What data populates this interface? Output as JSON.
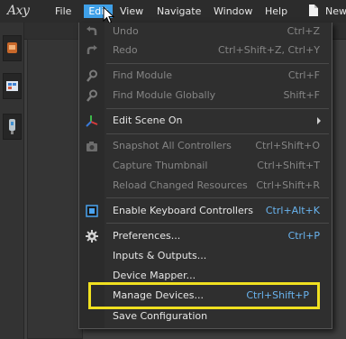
{
  "app": {
    "logo": "Axy"
  },
  "menubar": {
    "items": [
      {
        "label": "File"
      },
      {
        "label": "Edit"
      },
      {
        "label": "View"
      },
      {
        "label": "Navigate"
      },
      {
        "label": "Window"
      },
      {
        "label": "Help"
      },
      {
        "label": "New"
      }
    ],
    "active_color": "#3fa0e8"
  },
  "edit_menu": {
    "items": [
      {
        "label": "Undo",
        "shortcut": "Ctrl+Z",
        "enabled": false,
        "icon": "undo-icon"
      },
      {
        "label": "Redo",
        "shortcut": "Ctrl+Shift+Z, Ctrl+Y",
        "enabled": false,
        "icon": "redo-icon"
      },
      {
        "label": "Find Module",
        "shortcut": "Ctrl+F",
        "enabled": false,
        "icon": "magnifier-icon"
      },
      {
        "label": "Find Module Globally",
        "shortcut": "Shift+F",
        "enabled": false,
        "icon": "magnifier-icon"
      },
      {
        "label": "Edit Scene On",
        "shortcut": "",
        "enabled": true,
        "icon": "axes-icon",
        "submenu": true
      },
      {
        "label": "Snapshot All Controllers",
        "shortcut": "Ctrl+Shift+O",
        "enabled": false,
        "icon": "camera-icon"
      },
      {
        "label": "Capture Thumbnail",
        "shortcut": "Ctrl+Shift+T",
        "enabled": false
      },
      {
        "label": "Reload Changed Resources",
        "shortcut": "Ctrl+Shift+R",
        "enabled": false
      },
      {
        "label": "Enable Keyboard Controllers",
        "shortcut": "Ctrl+Alt+K",
        "enabled": true,
        "icon": "checkbox-icon",
        "checked": true
      },
      {
        "label": "Preferences...",
        "shortcut": "Ctrl+P",
        "enabled": true,
        "icon": "gear-icon"
      },
      {
        "label": "Inputs & Outputs...",
        "shortcut": "",
        "enabled": true
      },
      {
        "label": "Device Mapper...",
        "shortcut": "",
        "enabled": true
      },
      {
        "label": "Manage Devices...",
        "shortcut": "Ctrl+Shift+P",
        "enabled": true,
        "highlighted": true
      },
      {
        "label": "Save Configuration",
        "shortcut": "",
        "enabled": true
      }
    ],
    "accent_shortcut_color": "#69b4ef",
    "highlight_color": "#f0e020"
  }
}
